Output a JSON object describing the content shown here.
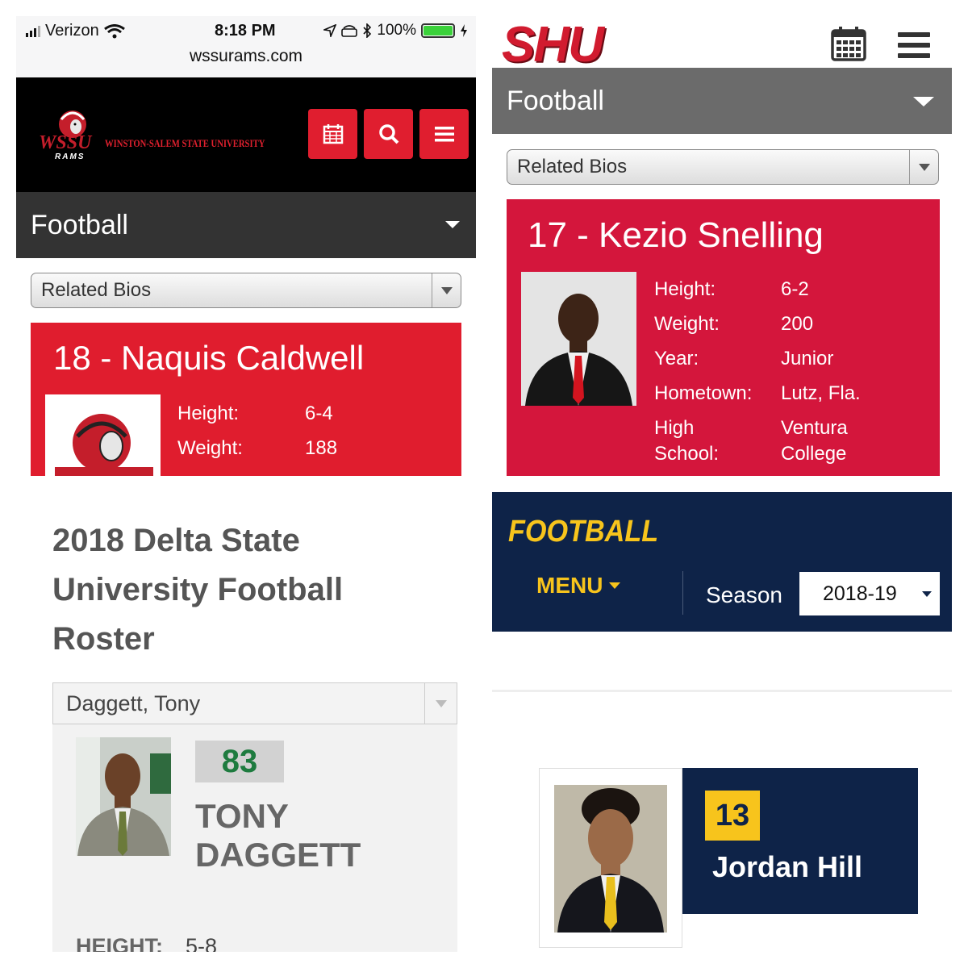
{
  "q1": {
    "status": {
      "carrier": "Verizon",
      "time": "8:18 PM",
      "battery": "100%",
      "url": "wssurams.com"
    },
    "header": {
      "school": "WINSTON-SALEM STATE UNIVERSITY",
      "logo_text": "WSSU",
      "logo_sub": "RAMS"
    },
    "section": "Football",
    "related": "Related Bios",
    "bio": {
      "name": "18 - Naquis Caldwell",
      "height_label": "Height:",
      "height": "6-4",
      "weight_label": "Weight:",
      "weight": "188"
    },
    "colors": {
      "red": "#e01d2e",
      "dark": "#333333"
    }
  },
  "q2": {
    "logo": "SHU",
    "section": "Football",
    "related": "Related Bios",
    "bio": {
      "name": "17 - Kezio Snelling",
      "rows": [
        {
          "label": "Height:",
          "value": "6-2"
        },
        {
          "label": "Weight:",
          "value": "200"
        },
        {
          "label": "Year:",
          "value": "Junior"
        },
        {
          "label": "Hometown:",
          "value": "Lutz, Fla."
        }
      ],
      "hs_label_1": "High",
      "hs_label_2": "School:",
      "hs_value_1": "Ventura",
      "hs_value_2": "College"
    },
    "colors": {
      "crimson": "#d4163c",
      "gray": "#6b6b6b"
    }
  },
  "q3": {
    "title": "2018 Delta State University Football Roster",
    "select": "Daggett, Tony",
    "number": "83",
    "first": "TONY",
    "last": "DAGGETT",
    "height_label": "HEIGHT:",
    "height": "5-8",
    "colors": {
      "green": "#1e7b3f"
    }
  },
  "q4": {
    "title": "FOOTBALL",
    "menu": "MENU",
    "season_label": "Season",
    "season_value": "2018-19",
    "number": "13",
    "name": "Jordan Hill",
    "colors": {
      "navy": "#0e2348",
      "gold": "#f7c41c"
    }
  }
}
